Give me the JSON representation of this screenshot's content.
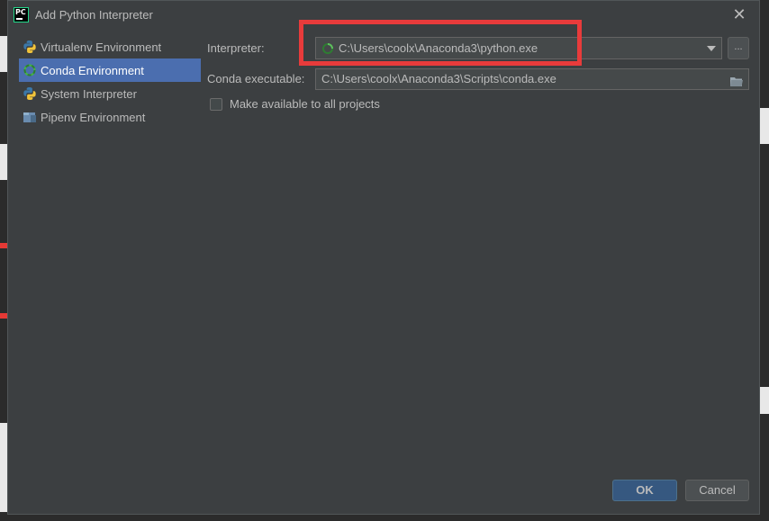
{
  "dialog": {
    "title": "Add Python Interpreter",
    "app_icon_text": "PC"
  },
  "sidebar": {
    "items": [
      {
        "label": "Virtualenv Environment",
        "icon": "python-icon",
        "selected": false
      },
      {
        "label": "Conda Environment",
        "icon": "conda-icon",
        "selected": true
      },
      {
        "label": "System Interpreter",
        "icon": "python-icon",
        "selected": false
      },
      {
        "label": "Pipenv Environment",
        "icon": "pipenv-icon",
        "selected": false
      }
    ]
  },
  "form": {
    "interpreter_label": "Interpreter:",
    "interpreter_value": "C:\\Users\\coolx\\Anaconda3\\python.exe",
    "browse_label": "...",
    "conda_label": "Conda executable:",
    "conda_value": "C:\\Users\\coolx\\Anaconda3\\Scripts\\conda.exe",
    "make_available_label": "Make available to all projects",
    "make_available_checked": false
  },
  "buttons": {
    "ok_label": "OK",
    "cancel_label": "Cancel"
  },
  "colors": {
    "dialog_bg": "#3c3f41",
    "selection": "#4b6eaf",
    "highlight": "#e83b3b",
    "ok_button": "#365880"
  }
}
